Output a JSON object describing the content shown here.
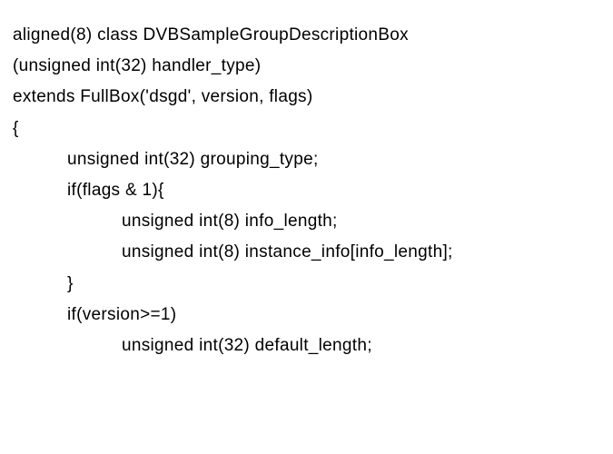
{
  "lines": [
    {
      "cls": "line",
      "text": "aligned(8) class DVBSampleGroupDescriptionBox"
    },
    {
      "cls": "line",
      "text": "(unsigned int(32) handler_type)"
    },
    {
      "cls": "line",
      "text": "extends FullBox('dsgd', version, flags)"
    },
    {
      "cls": "line",
      "text": "{"
    },
    {
      "cls": "line indent1",
      "text": "unsigned int(32) grouping_type;"
    },
    {
      "cls": "line indent1",
      "text": "if(flags & 1){"
    },
    {
      "cls": "line indent2",
      "text": "unsigned int(8) info_length;"
    },
    {
      "cls": "line indent2",
      "text": "unsigned int(8) instance_info[info_length];"
    },
    {
      "cls": "line indent1",
      "text": "}"
    },
    {
      "cls": "line indent1",
      "text": "if(version>=1)"
    },
    {
      "cls": "line indent2",
      "text": "unsigned int(32) default_length;"
    }
  ]
}
